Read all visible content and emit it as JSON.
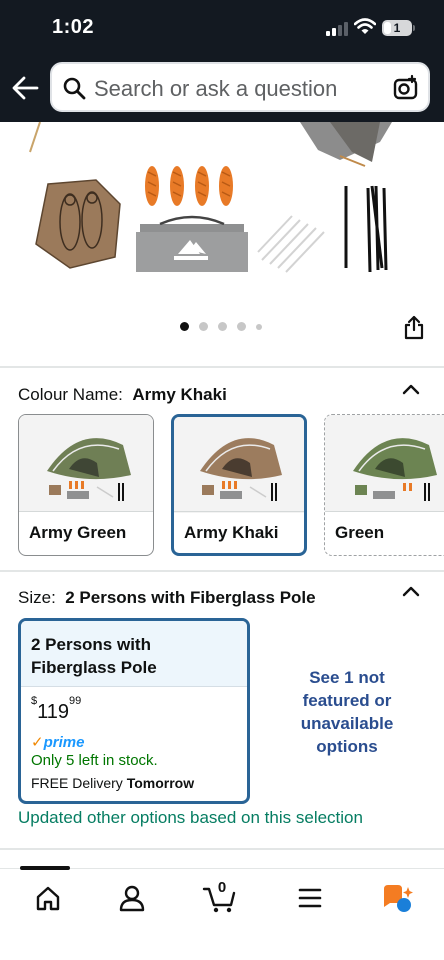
{
  "status_bar": {
    "time": "1:02",
    "battery": "1"
  },
  "header": {
    "search_placeholder": "Search or ask a question",
    "icons": [
      "back-arrow-icon",
      "search-icon",
      "camera-scan-icon"
    ]
  },
  "gallery": {
    "image_count": 5,
    "active_index": 0
  },
  "colour": {
    "label": "Colour Name:",
    "selected": "Army Khaki",
    "options": [
      {
        "name": "Army Green",
        "tent_color": "#6f7f55",
        "state": "normal"
      },
      {
        "name": "Army Khaki",
        "tent_color": "#9c7c5e",
        "state": "selected"
      },
      {
        "name": "Green",
        "tent_color": "#6c8452",
        "state": "unavailable"
      }
    ]
  },
  "size": {
    "label": "Size:",
    "selected": "2 Persons with Fiberglass Pole",
    "card": {
      "title": "2 Persons with Fiberglass Pole",
      "currency": "$",
      "price_whole": "119",
      "price_fraction": "99",
      "prime_label": "prime",
      "stock": "Only 5 left in stock.",
      "delivery_prefix": "FREE Delivery",
      "delivery_day": "Tomorrow"
    },
    "not_featured": "See 1 not featured or unavailable options",
    "updated_note": "Updated other options based on this selection"
  },
  "bottom_nav": {
    "items": [
      "home-icon",
      "account-icon",
      "cart-icon",
      "menu-icon",
      "rufus-ai-icon"
    ],
    "cart_count": "0"
  },
  "colors": {
    "header_bg": "#131921",
    "selected_border": "#2a6496",
    "in_stock_green": "#007600",
    "prime_blue": "#1a98ff",
    "accent_orange": "#f08804"
  }
}
